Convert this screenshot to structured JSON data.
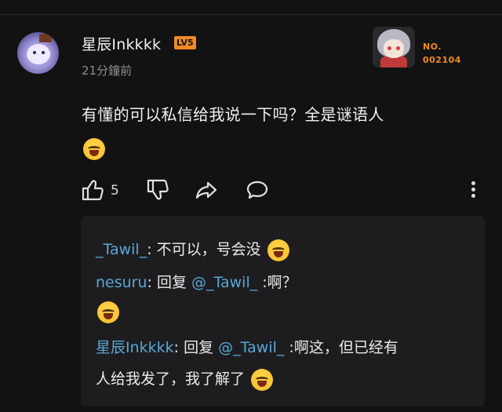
{
  "comment": {
    "username": "星辰Inkkkk",
    "level": "LV5",
    "time": "21分鐘前",
    "card": {
      "label": "NO.",
      "number": "002104"
    },
    "text": "有懂的可以私信给我说一下吗？全是谜语人",
    "like_count": "5"
  },
  "replies": [
    {
      "user": "_Tawil_",
      "sep": ": ",
      "text": "不可以，号会没",
      "emoji": true
    },
    {
      "user": "nesuru",
      "sep": ": ",
      "prefix": "回复 ",
      "mention": "@_Tawil_",
      "text": " :啊？"
    },
    {
      "user": "星辰Inkkkk",
      "sep": ": ",
      "prefix": "回复 ",
      "mention": "@_Tawil_",
      "text": " :啊这，但已经有",
      "continuation": "人给我发了，我了解了"
    }
  ],
  "icons": [
    "thumbs-up-icon",
    "thumbs-down-icon",
    "share-icon",
    "reply-bubble-icon",
    "more-vertical-icon",
    "laughing-crying-emoji"
  ],
  "colors": {
    "accent": "#f08a24",
    "link": "#5aa7d6",
    "background": "#121213",
    "reply_bg": "#1d1d20"
  }
}
